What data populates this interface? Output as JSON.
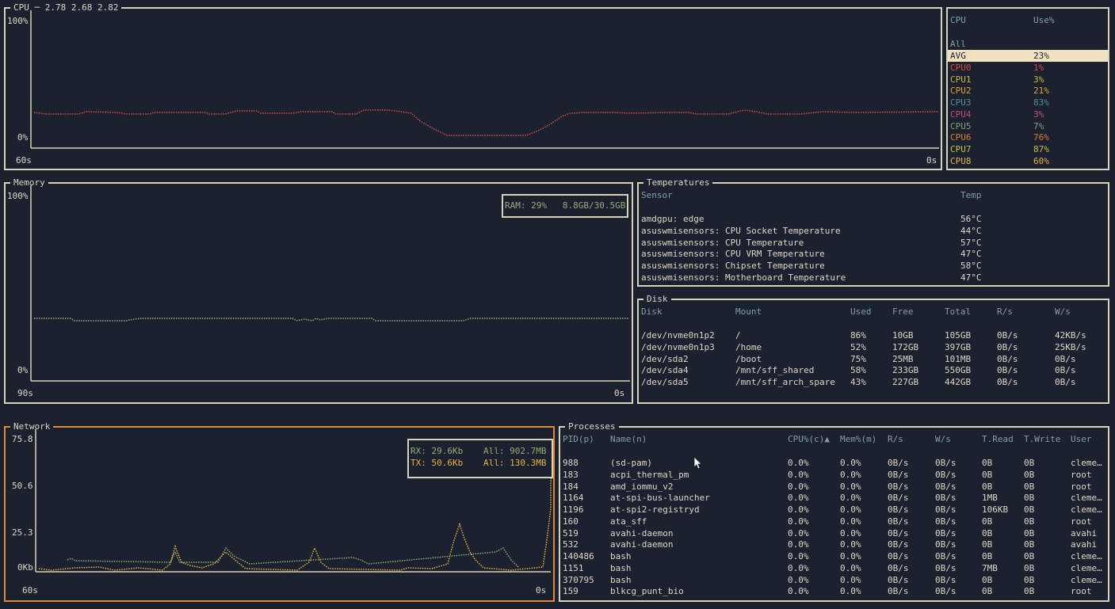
{
  "cpu_panel": {
    "title": "CPU",
    "loadavg": "2.78 2.68 2.82",
    "y_top": "100%",
    "y_bottom": "0%",
    "x_left": "60s",
    "x_right": "0s",
    "color": "#e04a3f"
  },
  "cpu_table": {
    "col_cpu": "CPU",
    "col_use": "Use%",
    "all_label": "All",
    "rows": [
      {
        "name": "AVG",
        "use": "23%",
        "color": "#1c2130"
      },
      {
        "name": "CPU0",
        "use": "1%",
        "color": "#d9463d"
      },
      {
        "name": "CPU1",
        "use": "3%",
        "color": "#c8b83a"
      },
      {
        "name": "CPU2",
        "use": "21%",
        "color": "#e0a030"
      },
      {
        "name": "CPU3",
        "use": "83%",
        "color": "#4f8f98"
      },
      {
        "name": "CPU4",
        "use": "3%",
        "color": "#b8507a"
      },
      {
        "name": "CPU5",
        "use": "7%",
        "color": "#7aa070"
      },
      {
        "name": "CPU6",
        "use": "76%",
        "color": "#e07a30"
      },
      {
        "name": "CPU7",
        "use": "87%",
        "color": "#c8c040"
      },
      {
        "name": "CPU8",
        "use": "60%",
        "color": "#e8b040"
      }
    ]
  },
  "memory_panel": {
    "title": "Memory",
    "y_top": "100%",
    "y_bottom": "0%",
    "x_left": "90s",
    "x_right": "0s",
    "legend": "RAM: 29%   8.8GB/30.5GB",
    "color": "#8fb070"
  },
  "temps": {
    "title": "Temperatures",
    "col_sensor": "Sensor",
    "col_temp": "Temp",
    "rows": [
      {
        "sensor": "amdgpu: edge",
        "temp": "56°C"
      },
      {
        "sensor": "asuswmisensors: CPU Socket Temperature",
        "temp": "44°C"
      },
      {
        "sensor": "asuswmisensors: CPU Temperature",
        "temp": "57°C"
      },
      {
        "sensor": "asuswmisensors: CPU VRM Temperature",
        "temp": "47°C"
      },
      {
        "sensor": "asuswmisensors: Chipset Temperature",
        "temp": "58°C"
      },
      {
        "sensor": "asuswmisensors: Motherboard Temperature",
        "temp": "47°C"
      }
    ]
  },
  "disk": {
    "title": "Disk",
    "headers": [
      "Disk",
      "Mount",
      "Used",
      "Free",
      "Total",
      "R/s",
      "W/s"
    ],
    "rows": [
      [
        "/dev/nvme0n1p2",
        "/",
        "86%",
        "10GB",
        "105GB",
        "0B/s",
        "42KB/s"
      ],
      [
        "/dev/nvme0n1p3",
        "/home",
        "52%",
        "172GB",
        "397GB",
        "0B/s",
        "25KB/s"
      ],
      [
        "/dev/sda2",
        "/boot",
        "75%",
        "25MB",
        "101MB",
        "0B/s",
        "0B/s"
      ],
      [
        "/dev/sda4",
        "/mnt/sff_shared",
        "58%",
        "233GB",
        "550GB",
        "0B/s",
        "0B/s"
      ],
      [
        "/dev/sda5",
        "/mnt/sff_arch_spare",
        "43%",
        "227GB",
        "442GB",
        "0B/s",
        "0B/s"
      ]
    ]
  },
  "network": {
    "title": "Network",
    "y_labels": [
      "75.8",
      "50.6",
      "25.3",
      "0Kb"
    ],
    "x_left": "60s",
    "x_right": "0s",
    "rx": "RX: 29.6Kb",
    "rx_all": "All: 902.7MB",
    "tx": "TX: 50.6Kb",
    "tx_all": "All: 130.3MB",
    "rx_color": "#8fb070",
    "tx_color": "#e8b040"
  },
  "processes": {
    "title": "Processes",
    "headers": [
      "PID(p)",
      "Name(n)",
      "CPU%(c)▲",
      "Mem%(m)",
      "R/s",
      "W/s",
      "T.Read",
      "T.Write",
      "User"
    ],
    "rows": [
      [
        "988",
        "(sd-pam)",
        "0.0%",
        "0.0%",
        "0B/s",
        "0B/s",
        "0B",
        "0B",
        "cleme…"
      ],
      [
        "183",
        "acpi_thermal_pm",
        "0.0%",
        "0.0%",
        "0B/s",
        "0B/s",
        "0B",
        "0B",
        "root"
      ],
      [
        "184",
        "amd_iommu_v2",
        "0.0%",
        "0.0%",
        "0B/s",
        "0B/s",
        "0B",
        "0B",
        "root"
      ],
      [
        "1164",
        "at-spi-bus-launcher",
        "0.0%",
        "0.0%",
        "0B/s",
        "0B/s",
        "1MB",
        "0B",
        "cleme…"
      ],
      [
        "1196",
        "at-spi2-registryd",
        "0.0%",
        "0.0%",
        "0B/s",
        "0B/s",
        "106KB",
        "0B",
        "cleme…"
      ],
      [
        "160",
        "ata_sff",
        "0.0%",
        "0.0%",
        "0B/s",
        "0B/s",
        "0B",
        "0B",
        "root"
      ],
      [
        "519",
        "avahi-daemon",
        "0.0%",
        "0.0%",
        "0B/s",
        "0B/s",
        "0B",
        "0B",
        "avahi"
      ],
      [
        "532",
        "avahi-daemon",
        "0.0%",
        "0.0%",
        "0B/s",
        "0B/s",
        "0B",
        "0B",
        "avahi"
      ],
      [
        "140486",
        "bash",
        "0.0%",
        "0.0%",
        "0B/s",
        "0B/s",
        "0B",
        "0B",
        "cleme…"
      ],
      [
        "1151",
        "bash",
        "0.0%",
        "0.0%",
        "0B/s",
        "0B/s",
        "7MB",
        "0B",
        "cleme…"
      ],
      [
        "370795",
        "bash",
        "0.0%",
        "0.0%",
        "0B/s",
        "0B/s",
        "0B",
        "0B",
        "cleme…"
      ],
      [
        "159",
        "blkcg_punt_bio",
        "0.0%",
        "0.0%",
        "0B/s",
        "0B/s",
        "0B",
        "0B",
        "root"
      ]
    ]
  }
}
